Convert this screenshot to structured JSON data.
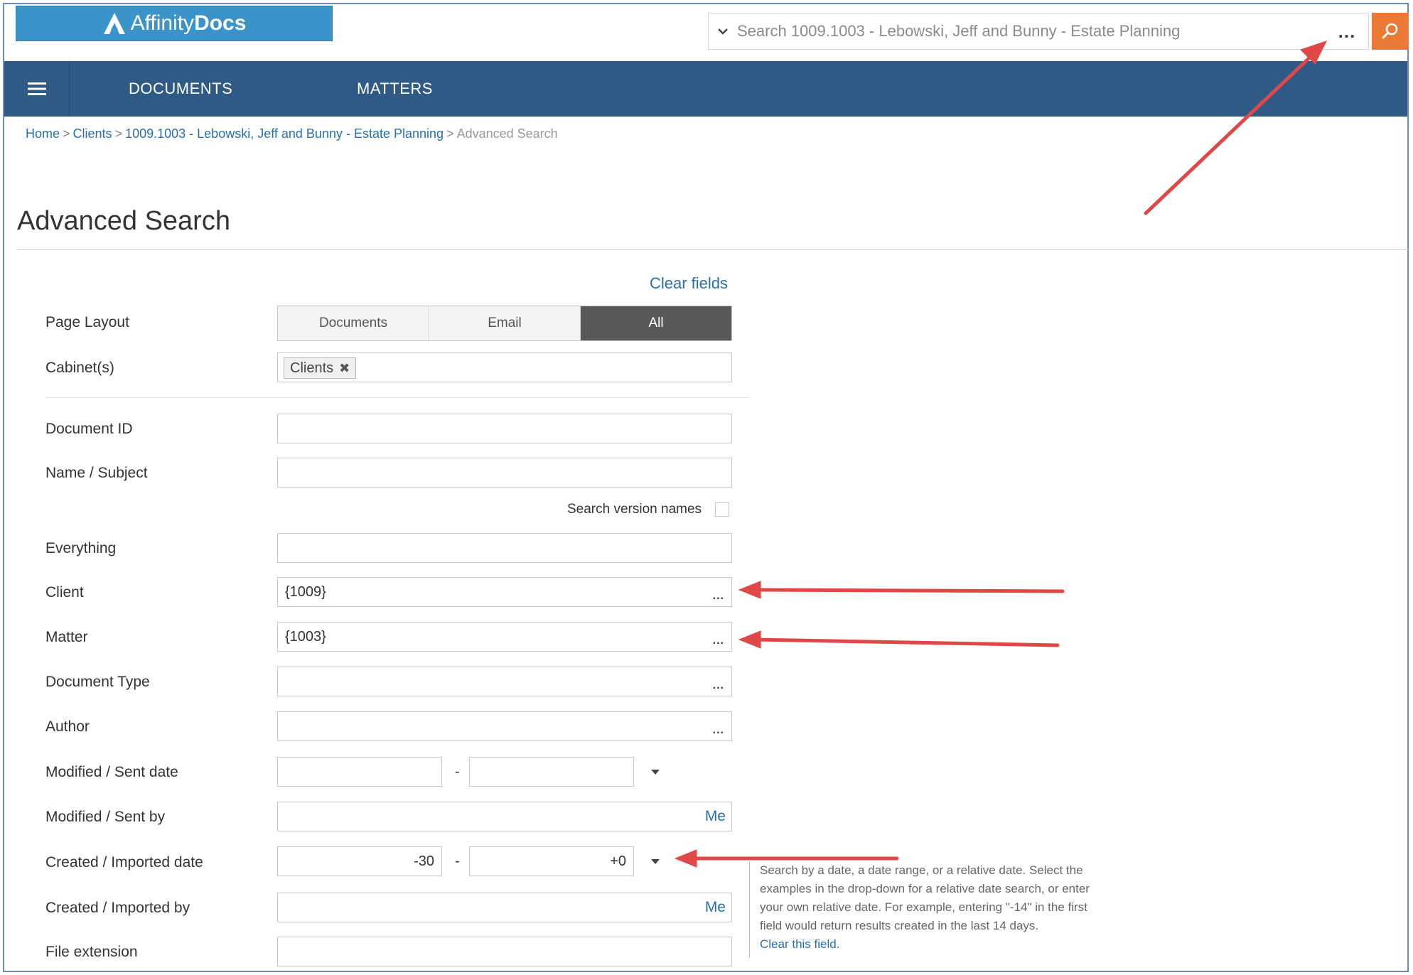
{
  "header": {
    "logo_text_regular": "Affinity",
    "logo_text_bold": "Docs",
    "search_placeholder": "Search 1009.1003 - Lebowski, Jeff and Bunny - Estate Planning",
    "more_label": "..."
  },
  "nav": {
    "documents": "DOCUMENTS",
    "matters": "MATTERS"
  },
  "breadcrumb": {
    "home": "Home",
    "clients": "Clients",
    "matter": "1009.1003 - Lebowski, Jeff and Bunny - Estate Planning",
    "current": "Advanced Search",
    "separator": ">"
  },
  "page": {
    "title": "Advanced Search",
    "clear_fields": "Clear fields"
  },
  "form": {
    "page_layout_label": "Page Layout",
    "page_layout_options": [
      "Documents",
      "Email",
      "All"
    ],
    "page_layout_selected": "All",
    "cabinets_label": "Cabinet(s)",
    "cabinet_tag": "Clients",
    "cabinet_tag_remove": "✖",
    "document_id_label": "Document ID",
    "name_subject_label": "Name / Subject",
    "search_version_names_label": "Search version names",
    "everything_label": "Everything",
    "client_label": "Client",
    "client_value": "{1009}",
    "matter_label": "Matter",
    "matter_value": "{1003}",
    "document_type_label": "Document Type",
    "author_label": "Author",
    "modified_sent_date_label": "Modified / Sent date",
    "modified_sent_by_label": "Modified / Sent by",
    "me_label": "Me",
    "created_imported_date_label": "Created / Imported date",
    "created_from": "-30",
    "created_to": "+0",
    "created_imported_by_label": "Created / Imported by",
    "file_extension_label": "File extension",
    "range_dash": "-",
    "lookup_dots": "..."
  },
  "help": {
    "line1": "Search by a date, a date range, or a relative date. Select the",
    "line2": "examples in the drop-down for a relative date search, or enter",
    "line3": "your own relative date. For example, entering \"-14\" in the first",
    "line4": "field would return results created in the last 14 days.",
    "clear_this_field": "Clear this field."
  },
  "colors": {
    "nav_bg": "#2f5a86",
    "logo_bg": "#3a93c9",
    "search_button": "#ea7a35",
    "link": "#2a6fad",
    "annotation_arrow": "#e04848",
    "selected_segment": "#595959"
  },
  "icons": {
    "logo": "affinity-a-logo-icon",
    "search": "search-icon",
    "chevron": "chevron-down-icon",
    "menu": "hamburger-menu-icon",
    "remove": "close-icon",
    "dropdown": "caret-down-icon"
  }
}
